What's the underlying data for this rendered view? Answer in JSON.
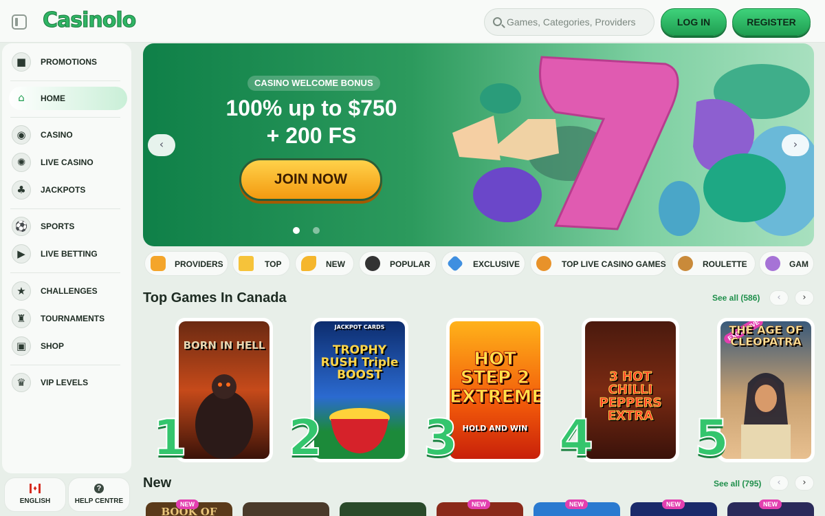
{
  "header": {
    "logo": "Casinolo",
    "search_placeholder": "Games, Categories, Providers",
    "login": "LOG IN",
    "register": "REGISTER"
  },
  "sidebar": {
    "items": [
      {
        "label": "PROMOTIONS",
        "icon": "gift-icon"
      },
      {
        "label": "HOME",
        "icon": "home-icon"
      },
      {
        "label": "CASINO",
        "icon": "casino-chip-icon"
      },
      {
        "label": "LIVE CASINO",
        "icon": "roulette-icon"
      },
      {
        "label": "JACKPOTS",
        "icon": "clubs-icon"
      },
      {
        "label": "SPORTS",
        "icon": "soccer-ball-icon"
      },
      {
        "label": "LIVE BETTING",
        "icon": "play-screen-icon"
      },
      {
        "label": "CHALLENGES",
        "icon": "star-icon"
      },
      {
        "label": "TOURNAMENTS",
        "icon": "trophy-icon"
      },
      {
        "label": "SHOP",
        "icon": "shopping-bag-icon"
      },
      {
        "label": "VIP LEVELS",
        "icon": "crown-icon"
      }
    ],
    "language": "ENGLISH",
    "help": "HELP CENTRE"
  },
  "banner": {
    "tag": "CASINO WELCOME BONUS",
    "title_line1": "100% up to $750",
    "title_line2": "+ 200 FS",
    "cta": "JOIN NOW",
    "prev": "‹",
    "next": "›"
  },
  "categories": [
    "PROVIDERS",
    "TOP",
    "NEW",
    "POPULAR",
    "EXCLUSIVE",
    "TOP LIVE CASINO GAMES",
    "ROULETTE",
    "GAM"
  ],
  "top_games": {
    "title": "Top Games In Canada",
    "see_all": "See all (586)",
    "games": [
      {
        "rank": "1",
        "name": "BORN IN HELL"
      },
      {
        "rank": "2",
        "name": "TROPHY RUSH Triple BOOST",
        "top": "JACKPOT CARDS"
      },
      {
        "rank": "3",
        "name": "HOT STEP 2 EXTREME",
        "sub": "HOLD AND WIN"
      },
      {
        "rank": "4",
        "name": "3 HOT CHILLI PEPPERS EXTRA"
      },
      {
        "rank": "5",
        "name": "THE AGE OF CLEOPATRA",
        "badge": "EXCLUSIVE"
      }
    ]
  },
  "new_games": {
    "title": "New",
    "see_all": "See all (795)",
    "badge": "NEW",
    "first_title": "BOOK OF"
  },
  "colors": {
    "brand_green": "#2fb464",
    "accent_gold": "#f5b020",
    "background": "#e8efe9"
  }
}
